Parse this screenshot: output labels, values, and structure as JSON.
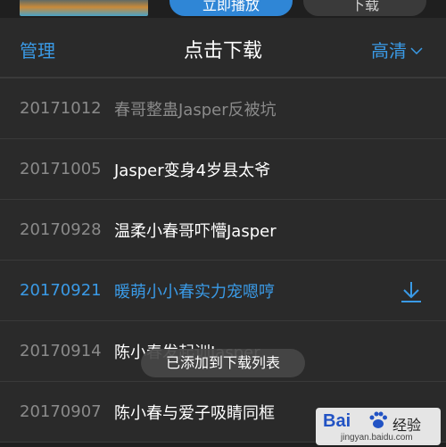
{
  "top": {
    "play_label": "立即播放",
    "download_label": "下载"
  },
  "header": {
    "manage_label": "管理",
    "title": "点击下载",
    "quality_label": "高清"
  },
  "episodes": [
    {
      "date": "20171012",
      "title": "春哥整蛊Jasper反被坑",
      "state": "dim"
    },
    {
      "date": "20171005",
      "title": "Jasper变身4岁县太爷",
      "state": "normal"
    },
    {
      "date": "20170928",
      "title": "温柔小春哥吓懵Jasper",
      "state": "normal"
    },
    {
      "date": "20170921",
      "title": "暖萌小小春实力宠嗯哼",
      "state": "active"
    },
    {
      "date": "20170914",
      "title": "陈小春发起训Jasper",
      "state": "normal"
    },
    {
      "date": "20170907",
      "title": "陈小春与爱子吸睛同框",
      "state": "normal"
    }
  ],
  "toast": {
    "text": "已添加到下载列表"
  },
  "watermark": {
    "logo": "Bai",
    "brand": "经验",
    "url": "jingyan.baidu.com"
  },
  "colors": {
    "accent": "#3a9ae6",
    "background": "#2a2a2a",
    "dim_text": "#8a8a8a"
  }
}
